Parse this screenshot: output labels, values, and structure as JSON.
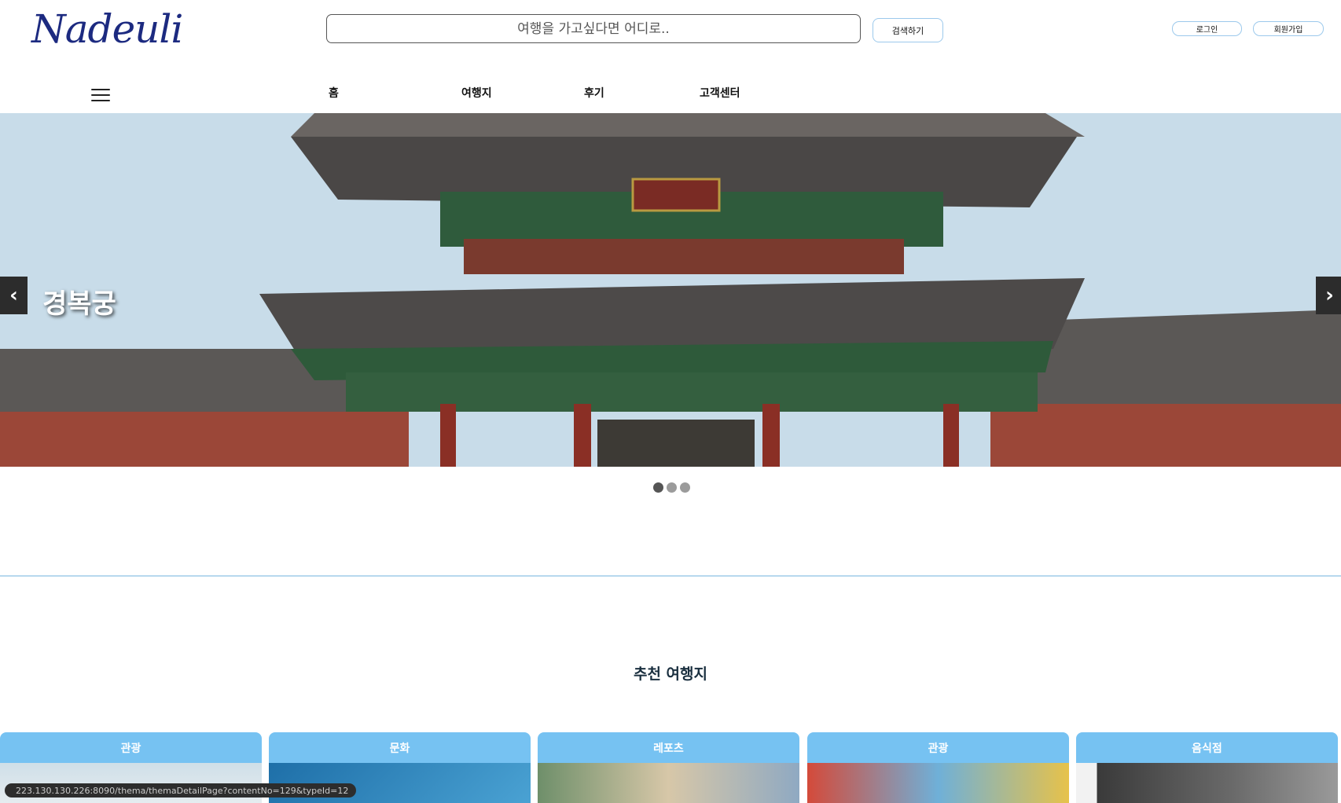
{
  "header": {
    "logo": "Nadeuli",
    "search_placeholder": "여행을 가고싶다면 어디로..",
    "search_button": "검색하기",
    "login": "로그인",
    "signup": "회원가입"
  },
  "nav": {
    "items": [
      "홈",
      "여행지",
      "후기",
      "고객센터"
    ]
  },
  "hero": {
    "title": "경복궁",
    "prev": "‹",
    "next": "›",
    "slide_count": 3,
    "active_slide": 1
  },
  "recommend": {
    "title": "추천 여행지",
    "cards": [
      {
        "category": "관광"
      },
      {
        "category": "문화"
      },
      {
        "category": "레포츠"
      },
      {
        "category": "관광"
      },
      {
        "category": "음식점"
      }
    ]
  },
  "status_url": "223.130.130.226:8090/thema/themaDetailPage?contentNo=129&typeId=12"
}
